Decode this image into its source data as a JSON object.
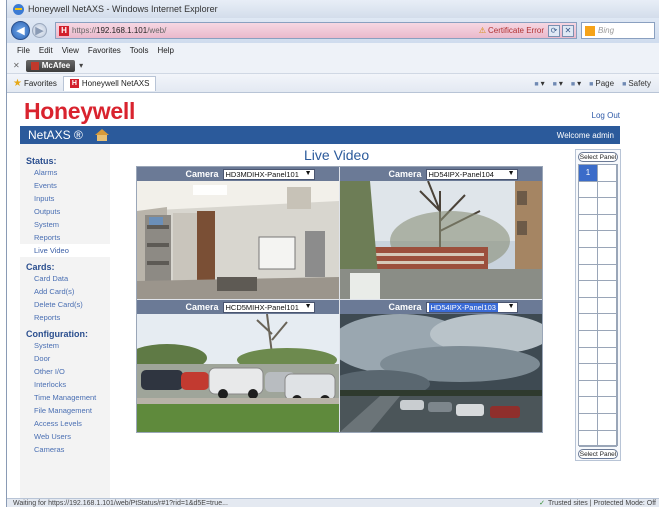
{
  "browser": {
    "title": "Honeywell NetAXS - Windows Internet Explorer",
    "url_prefix": "https://",
    "url_host": "192.168.1.101",
    "url_path": "/web/",
    "cert_error": "Certificate Error",
    "search_placeholder": "Bing",
    "menu": [
      "File",
      "Edit",
      "View",
      "Favorites",
      "Tools",
      "Help"
    ],
    "mcafee_label": "McAfee",
    "favorites_label": "Favorites",
    "fav_tab": "Honeywell NetAXS",
    "tools": [
      "Page",
      "Safety"
    ],
    "status_text": "Waiting for https://192.168.1.101/web/PtStatus/r#1?rid=1&d5E=true...",
    "status_right": "Trusted sites | Protected Mode: Off"
  },
  "page": {
    "brand": "Honeywell",
    "logout": "Log Out",
    "app_name": "NetAXS ®",
    "welcome": "Welcome admin",
    "title": "Live Video"
  },
  "sidebar": {
    "sections": [
      {
        "title": "Status:",
        "items": [
          "Alarms",
          "Events",
          "Inputs",
          "Outputs",
          "System",
          "Reports",
          "Live Video"
        ]
      },
      {
        "title": "Cards:",
        "items": [
          "Card Data",
          "Add Card(s)",
          "Delete Card(s)",
          "Reports"
        ]
      },
      {
        "title": "Configuration:",
        "items": [
          "System",
          "Door",
          "Other I/O",
          "Interlocks",
          "Time Management",
          "File Management",
          "Access Levels",
          "Web Users",
          "Cameras"
        ]
      }
    ],
    "active": "Live Video"
  },
  "cameras": [
    {
      "label": "Camera",
      "value": "HD3MDIHX-Panel101"
    },
    {
      "label": "Camera",
      "value": "HD54IPX-Panel104"
    },
    {
      "label": "Camera",
      "value": "HCD5MIHX-Panel101"
    },
    {
      "label": "Camera",
      "value": "HD54IPX-Panel103"
    }
  ],
  "panel": {
    "label_top": "Select Panel",
    "label_bottom": "Select Panel",
    "selected_number": "1"
  },
  "colors": {
    "brand_red": "#d9232e",
    "nav_blue": "#2b5a9b",
    "camera_header": "#6b7a96"
  }
}
